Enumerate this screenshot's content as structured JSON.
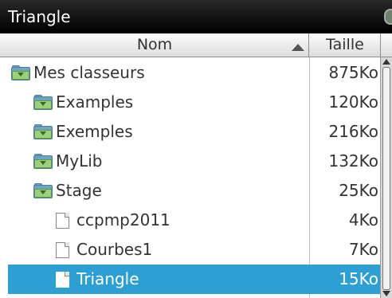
{
  "window": {
    "title": "Triangle",
    "status_icon": "battery-icon"
  },
  "columns": {
    "name": "Nom",
    "size": "Taille",
    "sort_icon": "sort-ascending-icon"
  },
  "rows": [
    {
      "name": "Mes classeurs",
      "size": "875Ko",
      "icon": "folder-open-icon"
    },
    {
      "name": "Examples",
      "size": "120Ko",
      "icon": "folder-icon"
    },
    {
      "name": "Exemples",
      "size": "216Ko",
      "icon": "folder-icon"
    },
    {
      "name": "MyLib",
      "size": "132Ko",
      "icon": "folder-icon"
    },
    {
      "name": "Stage",
      "size": "25Ko",
      "icon": "folder-open-icon"
    },
    {
      "name": "ccpmp2011",
      "size": "4Ko",
      "icon": "document-icon"
    },
    {
      "name": "Courbes1",
      "size": "7Ko",
      "icon": "document-icon"
    },
    {
      "name": "Triangle",
      "size": "15Ko",
      "icon": "document-icon",
      "selected": true
    }
  ],
  "colors": {
    "selection": "#2d9fd2",
    "title_bar": "#000000"
  }
}
